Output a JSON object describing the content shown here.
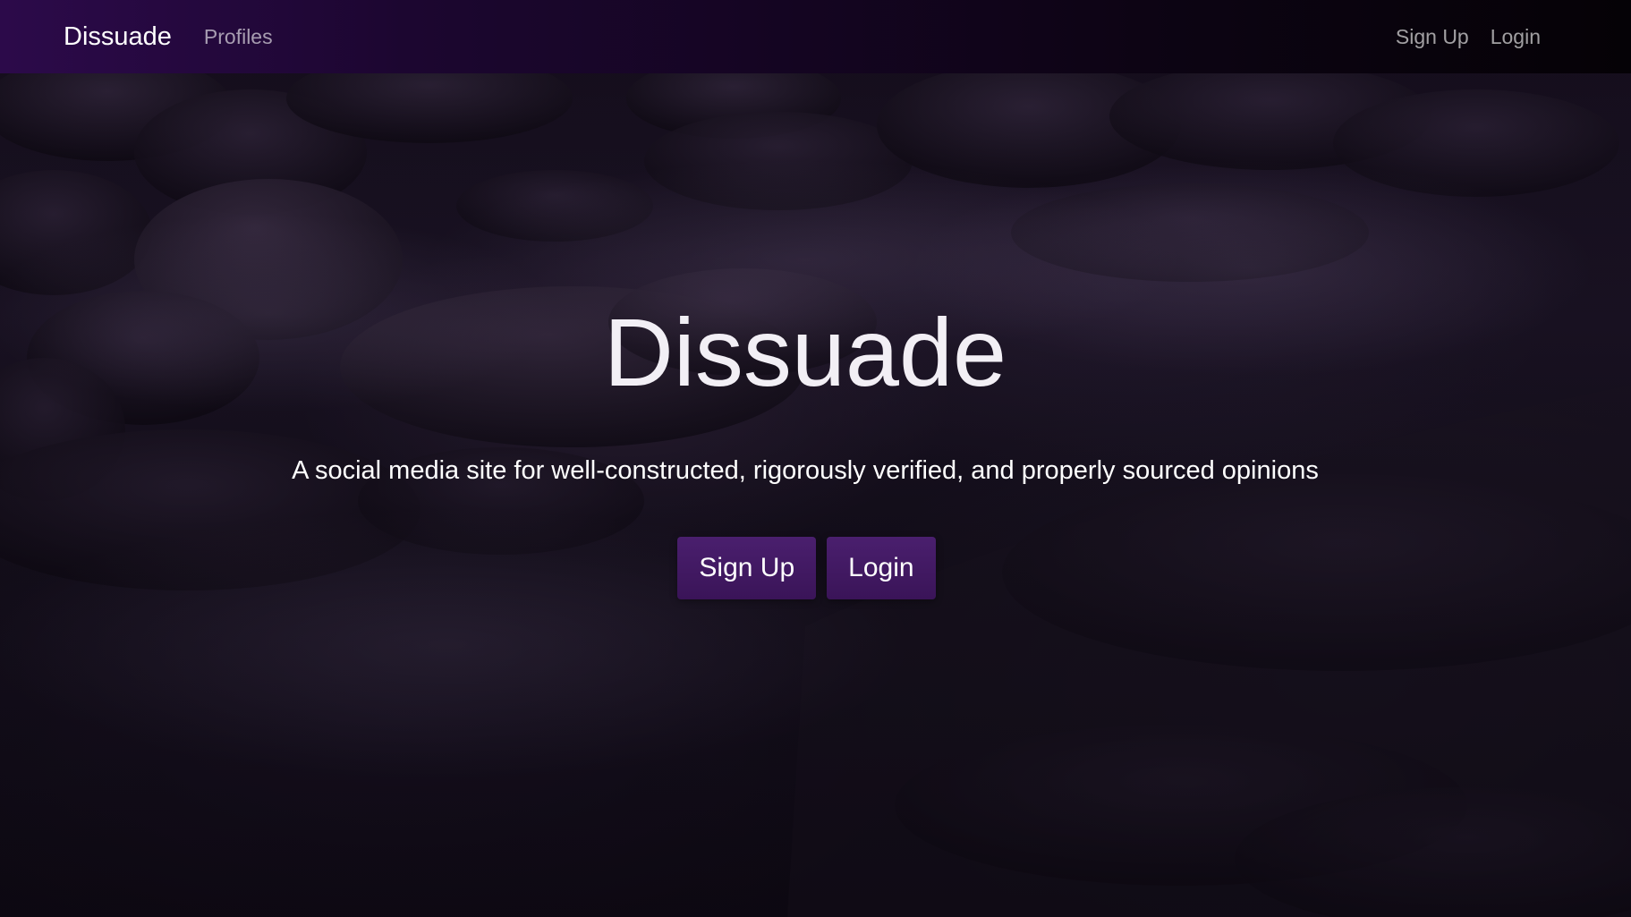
{
  "navbar": {
    "brand": "Dissuade",
    "links": [
      {
        "label": "Profiles"
      }
    ],
    "right_links": [
      {
        "label": "Sign Up"
      },
      {
        "label": "Login"
      }
    ]
  },
  "hero": {
    "title": "Dissuade",
    "subtitle": "A social media site for well-constructed, rigorously verified, and properly sourced opinions",
    "buttons": {
      "signup_label": "Sign Up",
      "login_label": "Login"
    }
  },
  "colors": {
    "accent": "#3f1762",
    "navbar_start": "#2c0a4a",
    "navbar_end": "#050206"
  }
}
